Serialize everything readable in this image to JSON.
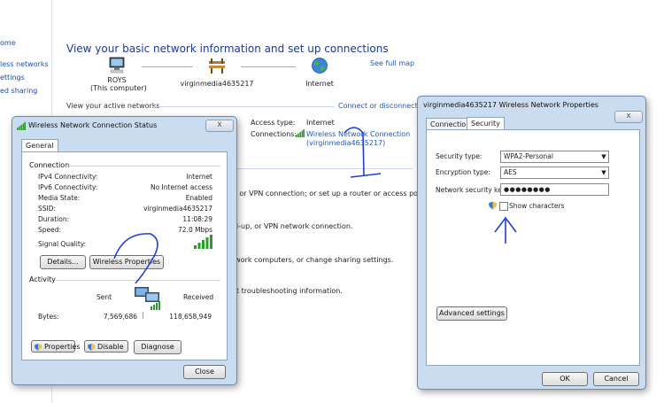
{
  "left_nav": {
    "items": [
      "ome",
      "less networks",
      "ettings",
      "ed sharing"
    ]
  },
  "main": {
    "title": "View your basic network information and set up connections",
    "see_full_map": "See full map",
    "computer_name": "ROYS",
    "computer_sub": "(This computer)",
    "network_name": "virginmedia4635217",
    "internet_label": "Internet",
    "active_networks_header": "View your active networks",
    "connect_disconnect": "Connect or disconnect",
    "access_type_label": "Access type:",
    "access_type_value": "Internet",
    "connections_label": "Connections:",
    "connection_link_line1": "Wireless Network Connection",
    "connection_link_line2": "(virginmedia4635217)",
    "tasks": [
      "r, or VPN connection; or set up a router or access point.",
      "al-up, or VPN network connection.",
      "twork computers, or change sharing settings.",
      "et troubleshooting information."
    ]
  },
  "status_dialog": {
    "title": "Wireless Network Connection Status",
    "tab": "General",
    "connection_group": "Connection",
    "rows": [
      {
        "label": "IPv4 Connectivity:",
        "value": "Internet"
      },
      {
        "label": "IPv6 Connectivity:",
        "value": "No Internet access"
      },
      {
        "label": "Media State:",
        "value": "Enabled"
      },
      {
        "label": "SSID:",
        "value": "virginmedia4635217"
      },
      {
        "label": "Duration:",
        "value": "11:08:29"
      },
      {
        "label": "Speed:",
        "value": "72.0 Mbps"
      }
    ],
    "signal_quality_label": "Signal Quality:",
    "details_button": "Details...",
    "wireless_properties_button": "Wireless Properties",
    "activity_group": "Activity",
    "sent_label": "Sent",
    "received_label": "Received",
    "bytes_label": "Bytes:",
    "bytes_sent": "7,569,686",
    "bytes_received": "118,658,949",
    "properties_button": "Properties",
    "disable_button": "Disable",
    "diagnose_button": "Diagnose",
    "close_button": "Close",
    "close_x": "x"
  },
  "props_dialog": {
    "title": "virginmedia4635217 Wireless Network Properties",
    "tab_connection": "Connection",
    "tab_security": "Security",
    "security_type_label": "Security type:",
    "security_type_value": "WPA2-Personal",
    "encryption_type_label": "Encryption type:",
    "encryption_type_value": "AES",
    "key_label": "Network security key",
    "key_value": "●●●●●●●●",
    "show_characters": "Show characters",
    "advanced_button": "Advanced settings",
    "ok_button": "OK",
    "cancel_button": "Cancel",
    "close_x": "x"
  },
  "colors": {
    "link": "#1a5bb7",
    "title": "#1e3a8f",
    "dialog_frame": "#c9dcf0",
    "annotation_ink": "#1f3fd6"
  }
}
